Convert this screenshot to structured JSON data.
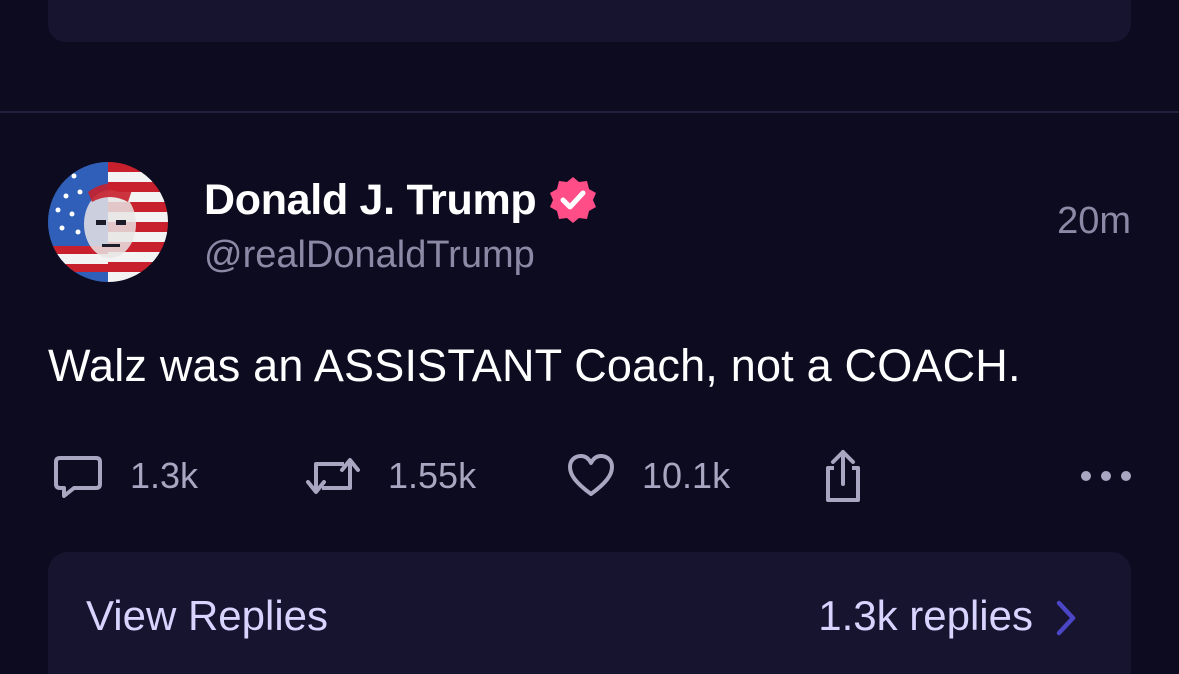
{
  "post": {
    "author_name": "Donald J. Trump",
    "author_handle": "@realDonaldTrump",
    "time": "20m",
    "text": "Walz was an ASSISTANT Coach, not a COACH.",
    "verified_color": "#ff4d88"
  },
  "actions": {
    "replies": "1.3k",
    "reposts": "1.55k",
    "likes": "10.1k"
  },
  "icons": [
    "comment-icon",
    "repost-icon",
    "heart-icon",
    "share-icon",
    "more-icon",
    "verified-badge-icon",
    "chevron-right-icon"
  ],
  "replies_card": {
    "label": "View Replies",
    "count": "1.3k replies"
  },
  "colors": {
    "background": "#0d0b1f",
    "card": "#171430",
    "muted_text": "#8c89a6",
    "accent": "#4b46c6"
  }
}
